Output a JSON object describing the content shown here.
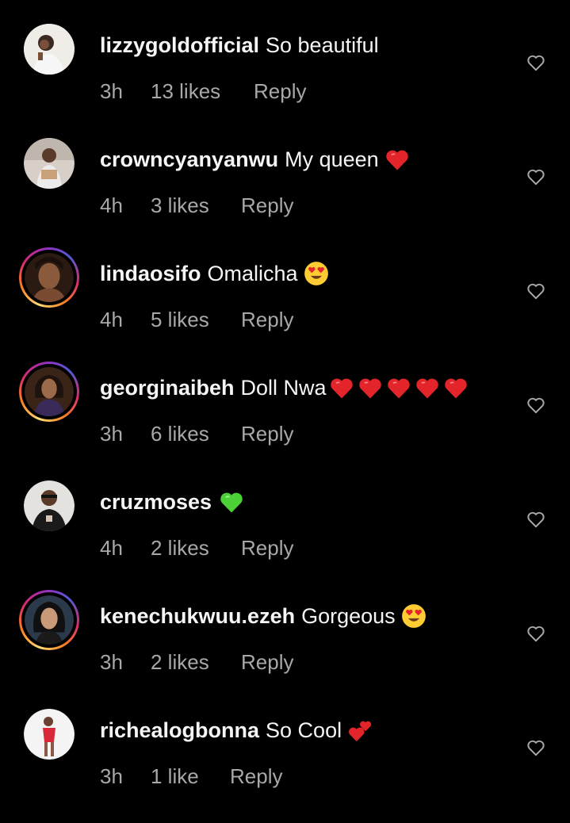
{
  "comments": [
    {
      "username": "lizzygoldofficial",
      "text": "So beautiful",
      "emojis": [],
      "time": "3h",
      "likes": "13 likes",
      "reply": "Reply",
      "story_ring": false
    },
    {
      "username": "crowncyanyanwu",
      "text": "My queen",
      "emojis": [
        "red-heart"
      ],
      "time": "4h",
      "likes": "3 likes",
      "reply": "Reply",
      "story_ring": false
    },
    {
      "username": "lindaosifo",
      "text": "Omalicha",
      "emojis": [
        "heart-eyes"
      ],
      "time": "4h",
      "likes": "5 likes",
      "reply": "Reply",
      "story_ring": true
    },
    {
      "username": "georginaibeh",
      "text": "Doll Nwa",
      "emojis": [
        "red-heart",
        "red-heart",
        "red-heart",
        "red-heart",
        "red-heart"
      ],
      "time": "3h",
      "likes": "6 likes",
      "reply": "Reply",
      "story_ring": true
    },
    {
      "username": "cruzmoses",
      "text": "",
      "emojis": [
        "green-heart"
      ],
      "time": "4h",
      "likes": "2 likes",
      "reply": "Reply",
      "story_ring": false
    },
    {
      "username": "kenechukwuu.ezeh",
      "text": "Gorgeous",
      "emojis": [
        "heart-eyes"
      ],
      "time": "3h",
      "likes": "2 likes",
      "reply": "Reply",
      "story_ring": true
    },
    {
      "username": "richealogbonna",
      "text": "So Cool",
      "emojis": [
        "two-hearts"
      ],
      "time": "3h",
      "likes": "1 like",
      "reply": "Reply",
      "story_ring": false
    }
  ],
  "colors": {
    "background": "#000000",
    "primary_text": "#f5f5f5",
    "secondary_text": "#a8a8a8",
    "red_heart": "#e3242b",
    "green_heart": "#4cd137"
  },
  "icons": {
    "like_button": "heart-outline-icon"
  }
}
